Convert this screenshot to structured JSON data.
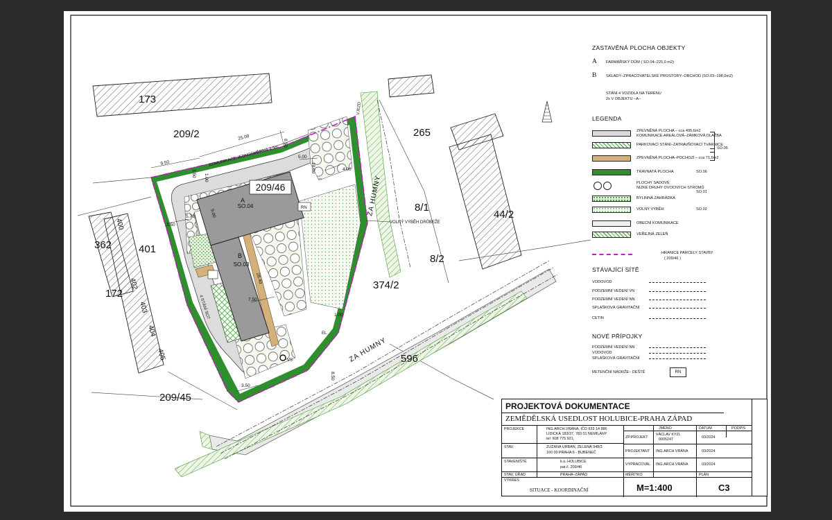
{
  "plan": {
    "parcel_main": "209/46",
    "parcels": [
      "173",
      "209/2",
      "265",
      "8/1",
      "44/2",
      "8/2",
      "362",
      "401",
      "172",
      "374/2",
      "596",
      "209/45",
      "400",
      "402",
      "403",
      "404",
      "405"
    ],
    "street_labels": [
      "ZA HUMNY",
      "ZA HUMNY"
    ],
    "objects": [
      {
        "letter": "A",
        "code": "SO.04"
      },
      {
        "letter": "B",
        "code": "SO.03"
      }
    ],
    "annotations": {
      "road": "KOMUNIKACE JEDNOSMĚRNÁ 3,5m",
      "parking": "4 STÁNÍ SO7",
      "poultry": "VOLNÝ VÝBĚH DRŮBEŽE",
      "vjezd": "VJEZD",
      "rn": "RN",
      "vs": "VS",
      "el": "EL"
    },
    "dims": [
      "25.00",
      "8.50",
      "9.50",
      "3.50",
      "5.00",
      "10.00",
      "4.00",
      "9.00",
      "5.70",
      "3.50",
      "7.50",
      "28.40",
      "3.50",
      "1.00",
      "1.00",
      "8.50"
    ]
  },
  "legend": {
    "zast_title": "ZASTAVĚNÁ PLOCHA OBJEKTY",
    "obj_a_letter": "A",
    "obj_a_text": "FARMÁŘSKÝ DŮM  ( SO.04–225,0 m2)",
    "obj_b_letter": "B",
    "obj_b_text": "SKLADY–ZPRACOVATELSKÉ PROSTORY–OBCHOD (SO.03–198,0m2)",
    "stani_1": "STÁNÍ 4 VOZIDLA NA TERÉNU",
    "stani_2": "2x V OBJEKTU –A–",
    "legenda_title": "LEGENDA",
    "items": [
      {
        "text": "ZPEVNĚNÁ PLOCHA – cca 495,6m2",
        "text2": "KOMUNIKACE AREÁLOVÁ–ZÁMKOVÁ DLAŽBA",
        "code": ""
      },
      {
        "text": "PARKOVACÍ STÁNÍ–ZATRAVŇOVACÍ TVÁRNICE",
        "text2": "",
        "code": ""
      },
      {
        "text": "ZPEVNĚNÁ PLOCHA–POCHOZÍ – cca 71,6m2",
        "text2": "",
        "code": ""
      },
      {
        "text": "TRAVNATÁ PLOCHA",
        "text2": "",
        "code": "SO.06"
      },
      {
        "text": "PLOCHY SADOVÉ",
        "text2": "NÍZKÉ DRUHY OVOCNÝCH STROMŮ",
        "code": "SO.01"
      },
      {
        "text": "BYLINNÁ ZAHRÁDKA",
        "text2": "",
        "code": ""
      },
      {
        "text": "VOLNÝ VÝBĚH",
        "text2": "",
        "code": "SO.02"
      },
      {
        "text": "OBECNÍ KOMUNIKACE",
        "text2": "",
        "code": ""
      },
      {
        "text": "VEŘEJNÁ ZELEŇ",
        "text2": "",
        "code": ""
      }
    ],
    "group_code": "SO.05",
    "hranice_1": "HRANICE PARCELY STAVBY",
    "hranice_2": "( 209/46 )",
    "site_title": "STÁVAJÍCÍ SÍTĚ",
    "site_items": [
      "VODOVOD",
      "PODZEMNÍ VEDENÍ VN",
      "PODZEMNÍ VEDENÍ NN",
      "SPLAŠKOVÁ GRAVITAČNÍ",
      "CETIN"
    ],
    "new_title": "NOVÉ PŘÍPOJKY",
    "new_items": [
      "PODZEMNÍ VEDENÍ NN",
      "VODOVOD",
      "SPLAŠKOVÁ GRAVITAČNÍ"
    ],
    "ret_text": "RETENČNÍ NÁDRŽE– DEŠTĚ",
    "ret_code": "RN"
  },
  "title_block": {
    "title": "PROJEKTOVÁ DOKUMENTACE",
    "project": "ZEMĚDĚLSKÁ USEDLOST HOLUBICE-PRAHA ZÁPAD",
    "projekce_label": "PROJEKCE",
    "projekce_1": "ING.ARCH.VRÁNA, IČO 633 14 886",
    "projekce_2": "LIDICKÁ 183/37, 783 01 NEMILANY",
    "projekce_3": "tel: 608 775 921,",
    "stav_label": "STAV.",
    "stav_1": "ZUZANA URBAN, ZELENÁ 948/3",
    "stav_2": "160 00 PRAHA  6 - BUBENEČ",
    "stavenist_label": "STAVENIŠTĚ",
    "stavenist_1": "k.ú. HOLUBICE",
    "stavenist_2": "par.č. 209/46",
    "urad_label": "STAV. ÚŘAD",
    "urad_value": "PRAHA–ZÁPAD",
    "vykres_label": "VÝKRES",
    "vykres_value": "SITUACE - KOORDINAČNÍ",
    "h_jmeno": "JMÉNO",
    "h_datum": "DATUM",
    "h_podpis": "PODPIS",
    "zp_label": "ZP.PROJEKT",
    "zp_name_1": "VÁCLAV KÝZL",
    "zp_name_2": "0005247",
    "zp_date": "03/2024",
    "proj_label": "PROJEKTANT",
    "proj_name": "ING.ARCH.VRÁNA",
    "proj_date": "03/2024",
    "vyp_label": "VYPRACOVAL",
    "vyp_name": "ING.ARCH.VRÁNA",
    "vyp_date": "03/2024",
    "meritko_label": "MĚŘÍTKO",
    "meritko_value": "M=1:400",
    "plan_label": "PLÁN",
    "plan_value": "C3"
  }
}
